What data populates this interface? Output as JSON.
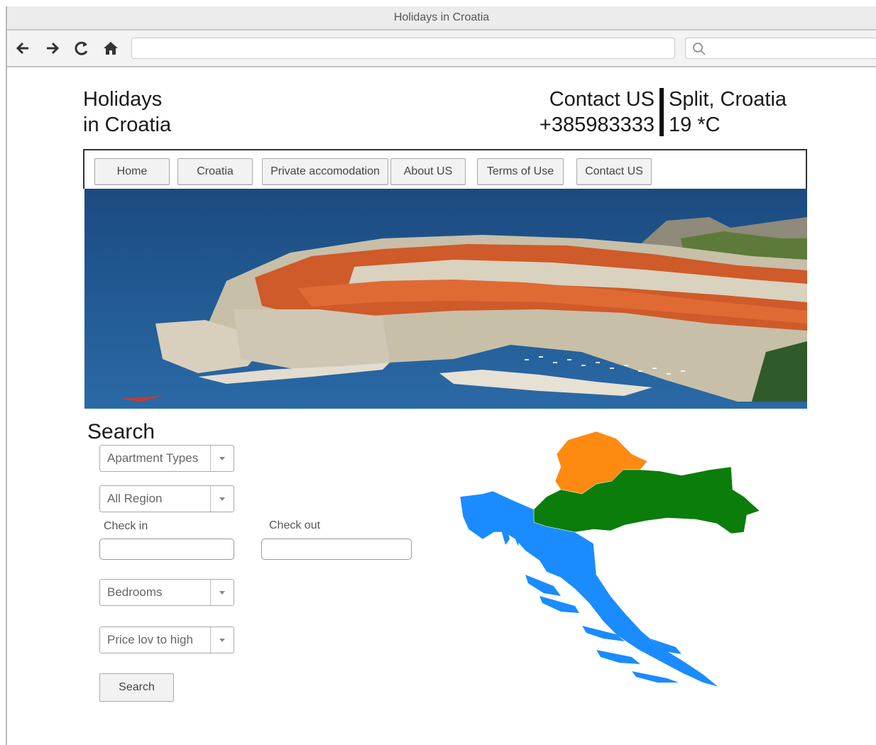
{
  "window": {
    "title": "Holidays in Croatia"
  },
  "browser": {
    "url": "",
    "search": ""
  },
  "header": {
    "title_line1": "Holidays",
    "title_line2": "in Croatia",
    "contact_label": "Contact US",
    "phone": "+385983333",
    "city": "Split, Croatia",
    "temperature": "19 *C"
  },
  "menu": {
    "items": [
      {
        "label": "Home"
      },
      {
        "label": "Croatia"
      },
      {
        "label": "Private accomodation"
      },
      {
        "label": "About US"
      },
      {
        "label": "Terms of Use"
      },
      {
        "label": "Contact US"
      }
    ]
  },
  "search": {
    "heading": "Search",
    "apartment_types": "Apartment Types",
    "region": "All Region",
    "check_in_label": "Check in",
    "check_out_label": "Check out",
    "check_in_value": "",
    "check_out_value": "",
    "bedrooms": "Bedrooms",
    "price_sort": "Price lov to high",
    "button_label": "Search"
  },
  "colors": {
    "map_orange": "#ff8a12",
    "map_green": "#0a7d0a",
    "map_blue": "#1a8cff",
    "sea": "#1f4f86"
  }
}
